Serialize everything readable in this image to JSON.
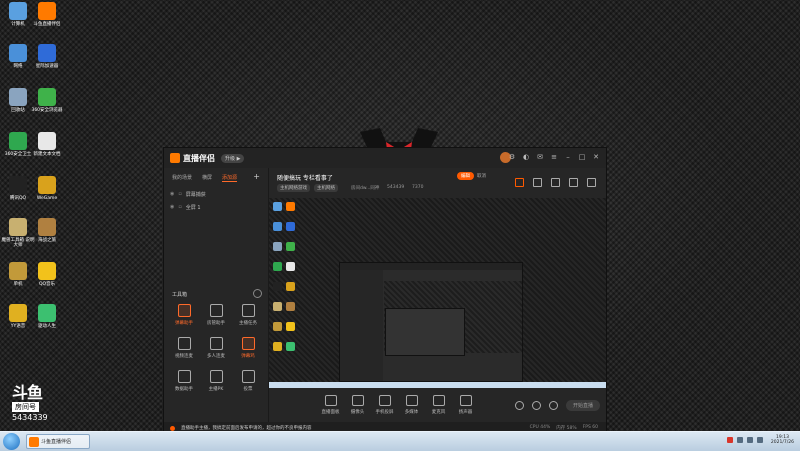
{
  "desktop": {
    "icons": [
      {
        "label": "计算机",
        "color": "#5aa0e0",
        "icon": "computer-icon"
      },
      {
        "label": "斗鱼直播伴侣",
        "color": "#ff7a00",
        "icon": "douyu-icon"
      },
      {
        "label": "网络",
        "color": "#4a90d9",
        "icon": "network-icon"
      },
      {
        "label": "星际加速器",
        "color": "#2f6bd8",
        "icon": "star-icon"
      },
      {
        "label": "回收站",
        "color": "#8aa4bf",
        "icon": "recycle-bin-icon"
      },
      {
        "label": "360安全浏览器",
        "color": "#3fb24a",
        "icon": "browser-icon"
      },
      {
        "label": "360安全卫士",
        "color": "#2fa84f",
        "icon": "shield-icon"
      },
      {
        "label": "新建文本文档",
        "color": "#e8e8e8",
        "icon": "text-document-icon"
      },
      {
        "label": "腾讯QQ",
        "color": "#222222",
        "icon": "qq-icon"
      },
      {
        "label": "WeGame",
        "color": "#d9a21c",
        "icon": "wegame-icon"
      },
      {
        "label": "魔兽工具箱\n说明大师",
        "color": "#c8b070",
        "icon": "tool-icon"
      },
      {
        "label": "海战之旅",
        "color": "#b08040",
        "icon": "game-icon"
      },
      {
        "label": "单机",
        "color": "#c29a3a",
        "icon": "game2-icon"
      },
      {
        "label": "QQ音乐",
        "color": "#f2c21b",
        "icon": "music-icon"
      },
      {
        "label": "YY语音",
        "color": "#e0b020",
        "icon": "yy-icon"
      },
      {
        "label": "驱动人生",
        "color": "#3cc070",
        "icon": "driver-icon"
      }
    ],
    "watermark": {
      "logo": "斗鱼",
      "room_label": "房间号",
      "room_number": "5434339"
    }
  },
  "app": {
    "brand": "直播伴侣",
    "brand_pill": "升级 ▶",
    "left": {
      "tabs": [
        "我的场景",
        "横屏",
        "添加源"
      ],
      "scenes": [
        {
          "label": "屏幕捕获"
        },
        {
          "label": "全屏 1"
        }
      ],
      "toolbox_title": "工具箱",
      "tools": [
        {
          "label": "弹幕助手",
          "orange": true
        },
        {
          "label": "房管助手",
          "orange": false
        },
        {
          "label": "主播任务",
          "orange": false
        },
        {
          "label": "视频连麦",
          "orange": false
        },
        {
          "label": "多人连麦",
          "orange": false
        },
        {
          "label": "弹幕鸡",
          "orange": true
        },
        {
          "label": "数据助手",
          "orange": false
        },
        {
          "label": "主播PK",
          "orange": false
        },
        {
          "label": "投票"
        }
      ]
    },
    "top": {
      "stream_title": "随便搞玩  专栏看事了",
      "edit_label": "编辑",
      "cancel_label": "取消",
      "tags": [
        "主机网络游戏",
        "主机网络"
      ],
      "meta": [
        "房间dw...同神",
        "543439",
        "7370"
      ]
    },
    "bottom": {
      "tools": [
        "直播面板",
        "摄像头",
        "手机投屏",
        "多媒体",
        "麦克风",
        "扬声器"
      ],
      "start_live": "开始直播"
    },
    "status": {
      "notice": "直播助手主播，我搞定前面后发布申请的，超过你的不良申报内容",
      "stats": [
        "CPU 44%",
        "内存 58%",
        "FPS 60"
      ]
    }
  },
  "taskbar": {
    "item": "斗鱼直播伴侣",
    "time": "19:13",
    "date": "2021/7/26"
  }
}
